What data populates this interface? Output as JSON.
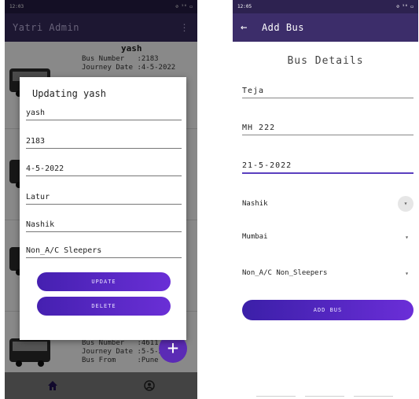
{
  "left": {
    "status": {
      "time": "12:03",
      "right": "⊘ ⁵⁶ ▭"
    },
    "appbar": {
      "title": "Yatri Admin",
      "menu": "⋮"
    },
    "card1": {
      "title": "yash",
      "lines": "Bus Number   :2183\nJourney Date :4-5-2022"
    },
    "card_bottom": {
      "lines": "Bus Number   :4611\nJourney Date :5-5-2022\nBus From     :Pune"
    },
    "dialog": {
      "title": "Updating yash",
      "fields": [
        "yash",
        "2183",
        "4-5-2022",
        "Latur",
        "Nashik",
        "Non_A/C Sleepers"
      ],
      "update_label": "UPDATE",
      "delete_label": "DELETE"
    },
    "fab_label": "+",
    "nav": {
      "home_icon": "home-icon",
      "account_icon": "account-icon"
    }
  },
  "right": {
    "status": {
      "time": "12:05",
      "right": "⊘ ⁵⁶ ▭"
    },
    "appbar": {
      "back": "←",
      "title": "Add Bus"
    },
    "form_title": "Bus Details",
    "fields": [
      "Teja",
      "MH 222",
      "21-5-2022"
    ],
    "dropdowns": [
      "Nashik",
      "Mumbai",
      "Non_A/C Non_Sleepers"
    ],
    "add_label": "ADD BUS"
  },
  "colors": {
    "primary": "#3c2d6a",
    "accent": "#5b2bb5"
  }
}
